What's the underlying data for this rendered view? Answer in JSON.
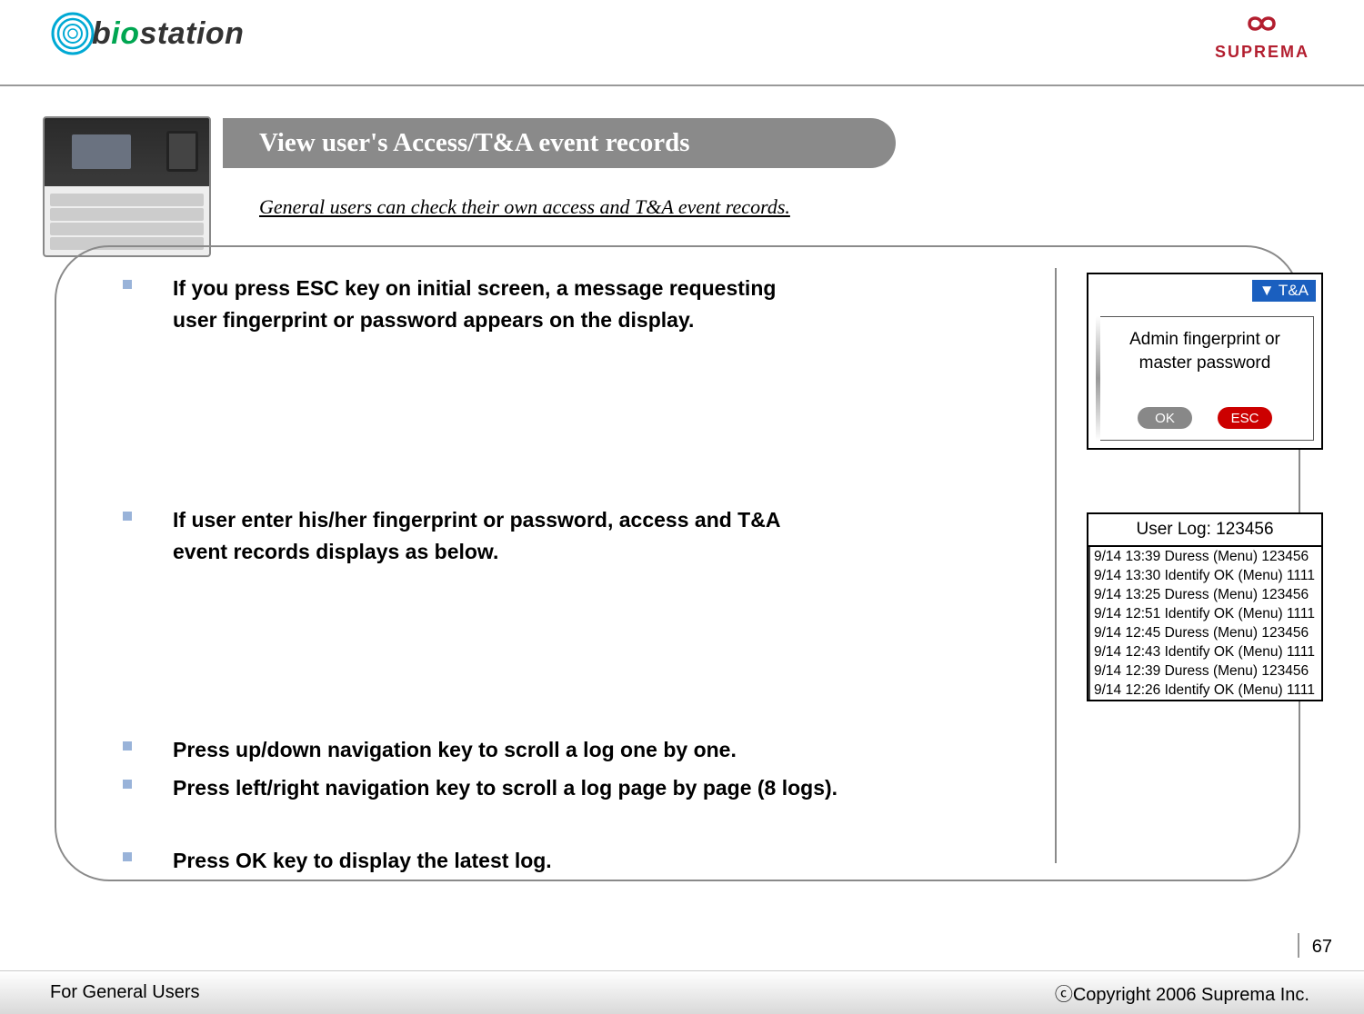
{
  "header": {
    "left_logo_text_b": "b",
    "left_logo_text_io": "io",
    "left_logo_text_rest": "station",
    "right_logo_text": "SUPREMA"
  },
  "title": "View user's Access/T&A event records",
  "subtitle": "General users can check their own access and T&A event records.",
  "bullets": {
    "b1": "If you press ESC key on initial screen, a message requesting user fingerprint or password appears on the display.",
    "b2": "If user enter his/her fingerprint or password, access and T&A event records displays as below.",
    "b3": "Press up/down navigation key to scroll a log one by one.",
    "b4": "Press left/right navigation key to scroll a log page by page (8 logs).",
    "b5": "Press OK key to display the latest log."
  },
  "screen1": {
    "ta_label": "▼ T&A",
    "prompt_l1": "Admin fingerprint or",
    "prompt_l2": "master password",
    "ok": "OK",
    "esc": "ESC"
  },
  "screen2": {
    "title": "User Log: 123456",
    "lines": [
      "9/14 13:39 Duress (Menu) 123456",
      "9/14 13:30 Identify OK (Menu) 1111",
      "9/14 13:25 Duress (Menu) 123456",
      "9/14 12:51 Identify OK (Menu) 1111",
      "9/14 12:45 Duress (Menu) 123456",
      "9/14 12:43 Identify OK (Menu) 1111",
      "9/14 12:39 Duress (Menu) 123456",
      "9/14 12:26 Identify OK (Menu) 1111"
    ]
  },
  "page_num": "67",
  "footer": {
    "left": "For General Users",
    "right": "ⓒCopyright 2006 Suprema Inc."
  }
}
